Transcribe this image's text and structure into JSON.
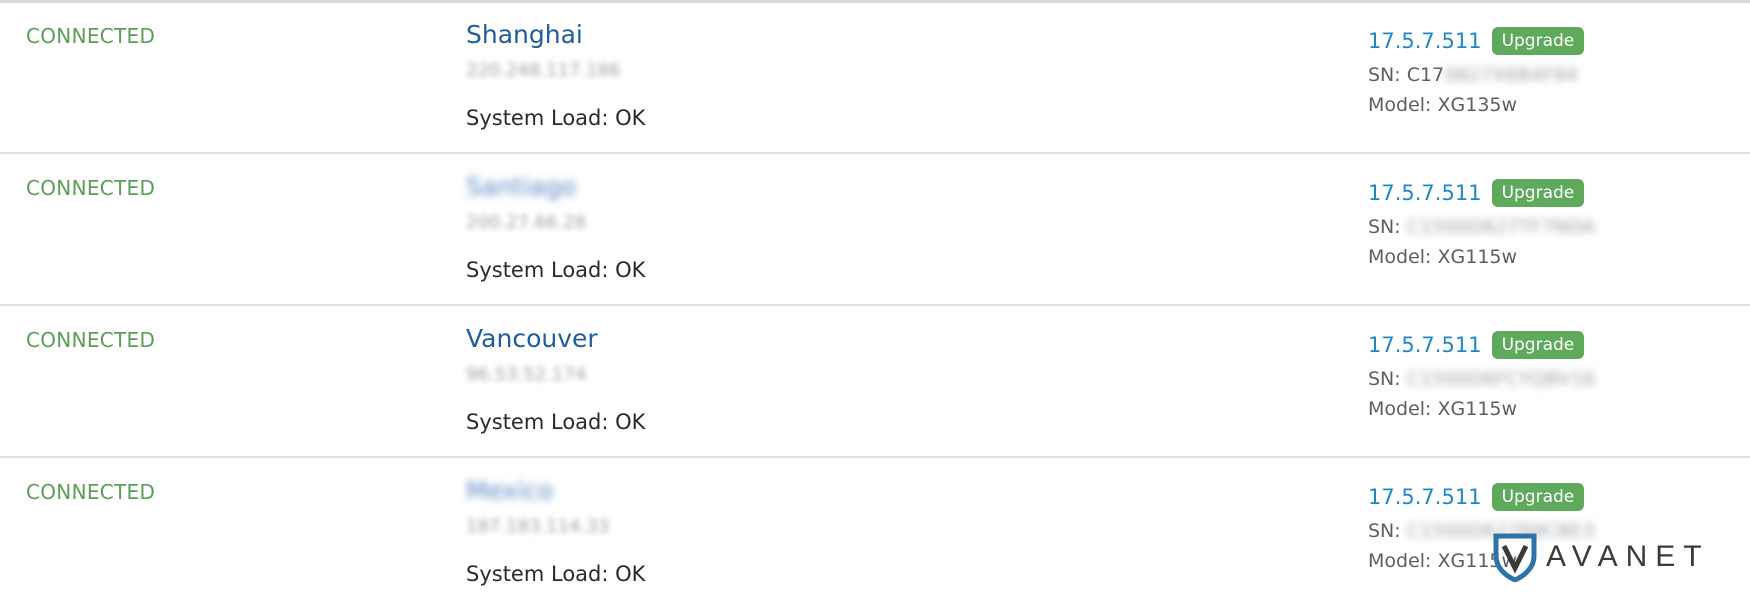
{
  "rows": [
    {
      "status": "CONNECTED",
      "location": "Shanghai",
      "location_blurred": false,
      "ip": "220.248.117.186",
      "system_load": "System Load: OK",
      "version": "17.5.7.511",
      "upgrade_label": "Upgrade",
      "sn_label": "SN:",
      "sn_visible": "C17",
      "sn_hidden": "0827X6B4F84",
      "model": "Model: XG135w"
    },
    {
      "status": "CONNECTED",
      "location": "Santiago",
      "location_blurred": true,
      "ip": "200.27.66.28",
      "system_load": "System Load: OK",
      "version": "17.5.7.511",
      "upgrade_label": "Upgrade",
      "sn_label": "SN:",
      "sn_visible": "",
      "sn_hidden": "C1500D627TF7NDA",
      "model": "Model: XG115w"
    },
    {
      "status": "CONNECTED",
      "location": "Vancouver",
      "location_blurred": false,
      "ip": "96.53.52.174",
      "system_load": "System Load: OK",
      "version": "17.5.7.511",
      "upgrade_label": "Upgrade",
      "sn_label": "SN:",
      "sn_visible": "",
      "sn_hidden": "C1500D6FCYQBV16",
      "model": "Model: XG115w"
    },
    {
      "status": "CONNECTED",
      "location": "Mexico",
      "location_blurred": true,
      "ip": "187.183.114.33",
      "system_load": "System Load: OK",
      "version": "17.5.7.511",
      "upgrade_label": "Upgrade",
      "sn_label": "SN:",
      "sn_visible": "",
      "sn_hidden": "C1500D627B9CBE3",
      "model": "Model: XG115w"
    }
  ],
  "watermark": {
    "text": "AVANET",
    "icon": "shield-logo-icon"
  },
  "colors": {
    "connected": "#5a9e55",
    "location": "#1f5d9c",
    "version": "#1f87c4",
    "upgrade_button": "#5fa95c"
  }
}
